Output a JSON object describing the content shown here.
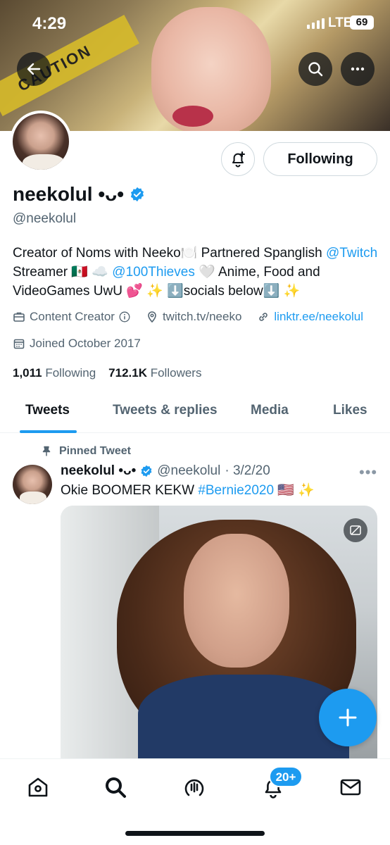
{
  "status_bar": {
    "time": "4:29",
    "network": "LTE",
    "battery": "69"
  },
  "profile": {
    "display_name": "neekolul •ᴗ•",
    "handle": "@neekolul",
    "follow_button": "Following",
    "bio": {
      "part1": "Creator of Noms with Neeko🍽️ Partnered Spanglish ",
      "link_twitch": "@Twitch",
      "part2": " Streamer 🇲🇽 ☁️ ",
      "link_100t": "@100Thieves",
      "part3": " 🤍 Anime, Food and VideoGames UwU 💕 ✨ ⬇️socials below⬇️ ✨"
    },
    "category": "Content Creator",
    "location": "twitch.tv/neeko",
    "website": "linktr.ee/neekolul",
    "joined": "Joined October 2017",
    "following_count": "1,011",
    "following_label": "Following",
    "followers_count": "712.1K",
    "followers_label": "Followers"
  },
  "tabs": [
    {
      "label": "Tweets",
      "active": true
    },
    {
      "label": "Tweets & replies",
      "active": false
    },
    {
      "label": "Media",
      "active": false
    },
    {
      "label": "Likes",
      "active": false
    }
  ],
  "pinned_tweet": {
    "pinned_label": "Pinned Tweet",
    "author_name": "neekolul •ᴗ•",
    "author_handle": "@neekolul",
    "date": "· 3/2/20",
    "text_main": "Okie BOOMER KEKW ",
    "hashtag": "#Bernie2020",
    "text_tail": " 🇺🇸 ✨"
  },
  "bottom_nav": {
    "items": [
      "home-icon",
      "search-icon",
      "spaces-icon",
      "notifications-icon",
      "messages-icon"
    ],
    "notification_badge": "20+"
  },
  "colors": {
    "accent": "#1d9bf0",
    "text": "#0f1419",
    "secondary": "#536471"
  }
}
